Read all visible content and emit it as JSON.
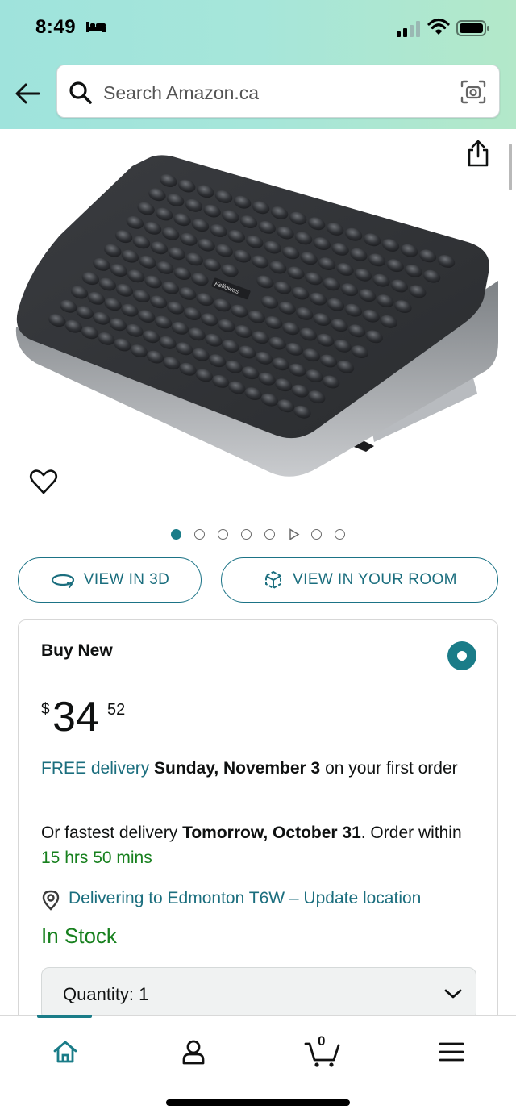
{
  "status_bar": {
    "time": "8:49"
  },
  "search": {
    "placeholder": "Search Amazon.ca"
  },
  "gallery": {
    "brand_text": "Fellowes",
    "image_count": 8,
    "active_index": 0,
    "video_index": 5
  },
  "actions": {
    "view_3d_label": "VIEW IN 3D",
    "view_room_label": "VIEW IN YOUR ROOM"
  },
  "buy_box": {
    "title": "Buy New",
    "price": {
      "symbol": "$",
      "whole": "34",
      "fraction": "52"
    },
    "free_delivery": {
      "prefix": "FREE delivery",
      "date": "Sunday, November 3",
      "suffix": " on your first order"
    },
    "fast_delivery": {
      "prefix": "Or fastest delivery ",
      "date": "Tomorrow, October 31",
      "middle": ". Order within ",
      "countdown": "15 hrs 50 mins"
    },
    "location": "Delivering to Edmonton T6W – Update location",
    "stock": "In Stock",
    "quantity_label": "Quantity:",
    "quantity_value": "1"
  },
  "bottom_nav": {
    "cart_count": "0",
    "active_tab": "home"
  },
  "colors": {
    "accent": "#1a7c88",
    "link": "#1b6e7e",
    "in_stock": "#17801e",
    "header_gradient_start": "#9fe3dc"
  }
}
